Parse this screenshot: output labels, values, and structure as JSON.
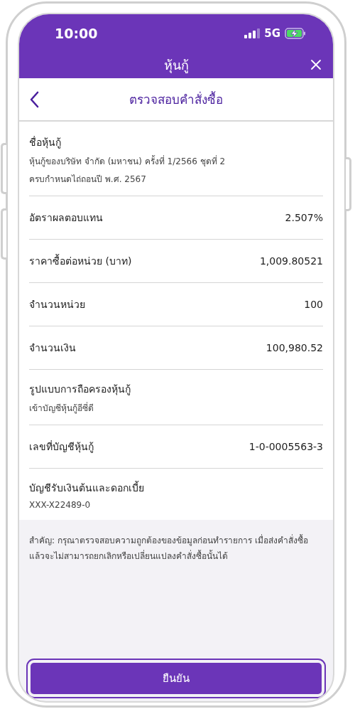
{
  "status_bar": {
    "time": "10:00",
    "network": "5G"
  },
  "header": {
    "title": "หุ้นกู้"
  },
  "nav": {
    "title": "ตรวจสอบคำสั่งซื้อ"
  },
  "details": [
    {
      "kind": "stacked",
      "label": "ชื่อหุ้นกู้",
      "lines": [
        "หุ้นกู้ของบริษัท จำกัด (มหาชน) ครั้งที่ 1/2566 ชุดที่ 2",
        "ครบกำหนดไถ่ถอนปี พ.ศ. 2567"
      ]
    },
    {
      "kind": "inline",
      "label": "อัตราผลตอบแทน",
      "value": "2.507%"
    },
    {
      "kind": "inline",
      "label": "ราคาซื้อต่อหน่วย (บาท)",
      "value": "1,009.80521"
    },
    {
      "kind": "inline",
      "label": "จำนวนหน่วย",
      "value": "100"
    },
    {
      "kind": "inline",
      "label": "จำนวนเงิน",
      "value": "100,980.52"
    },
    {
      "kind": "stacked",
      "label": "รูปแบบการถือครองหุ้นกู้",
      "lines": [
        "เข้าบัญชีหุ้นกู้อีซี่ดี"
      ]
    },
    {
      "kind": "inline",
      "label": "เลขที่บัญชีหุ้นกู้",
      "value": "1-0-0005563-3"
    },
    {
      "kind": "stacked",
      "label": "บัญชีรับเงินต้นและดอกเบี้ย",
      "lines": [
        "XXX-X22489-0"
      ]
    }
  ],
  "notice": "สำคัญ: กรุณาตรวจสอบความถูกต้องของข้อมูลก่อนทำรายการ เมื่อส่งคำสั่งซื้อแล้วจะไม่สามารถยกเลิกหรือเปลี่ยนแปลงคำสั่งซื้อนั้นได้",
  "confirm_button": {
    "label": "ยืนยัน"
  }
}
